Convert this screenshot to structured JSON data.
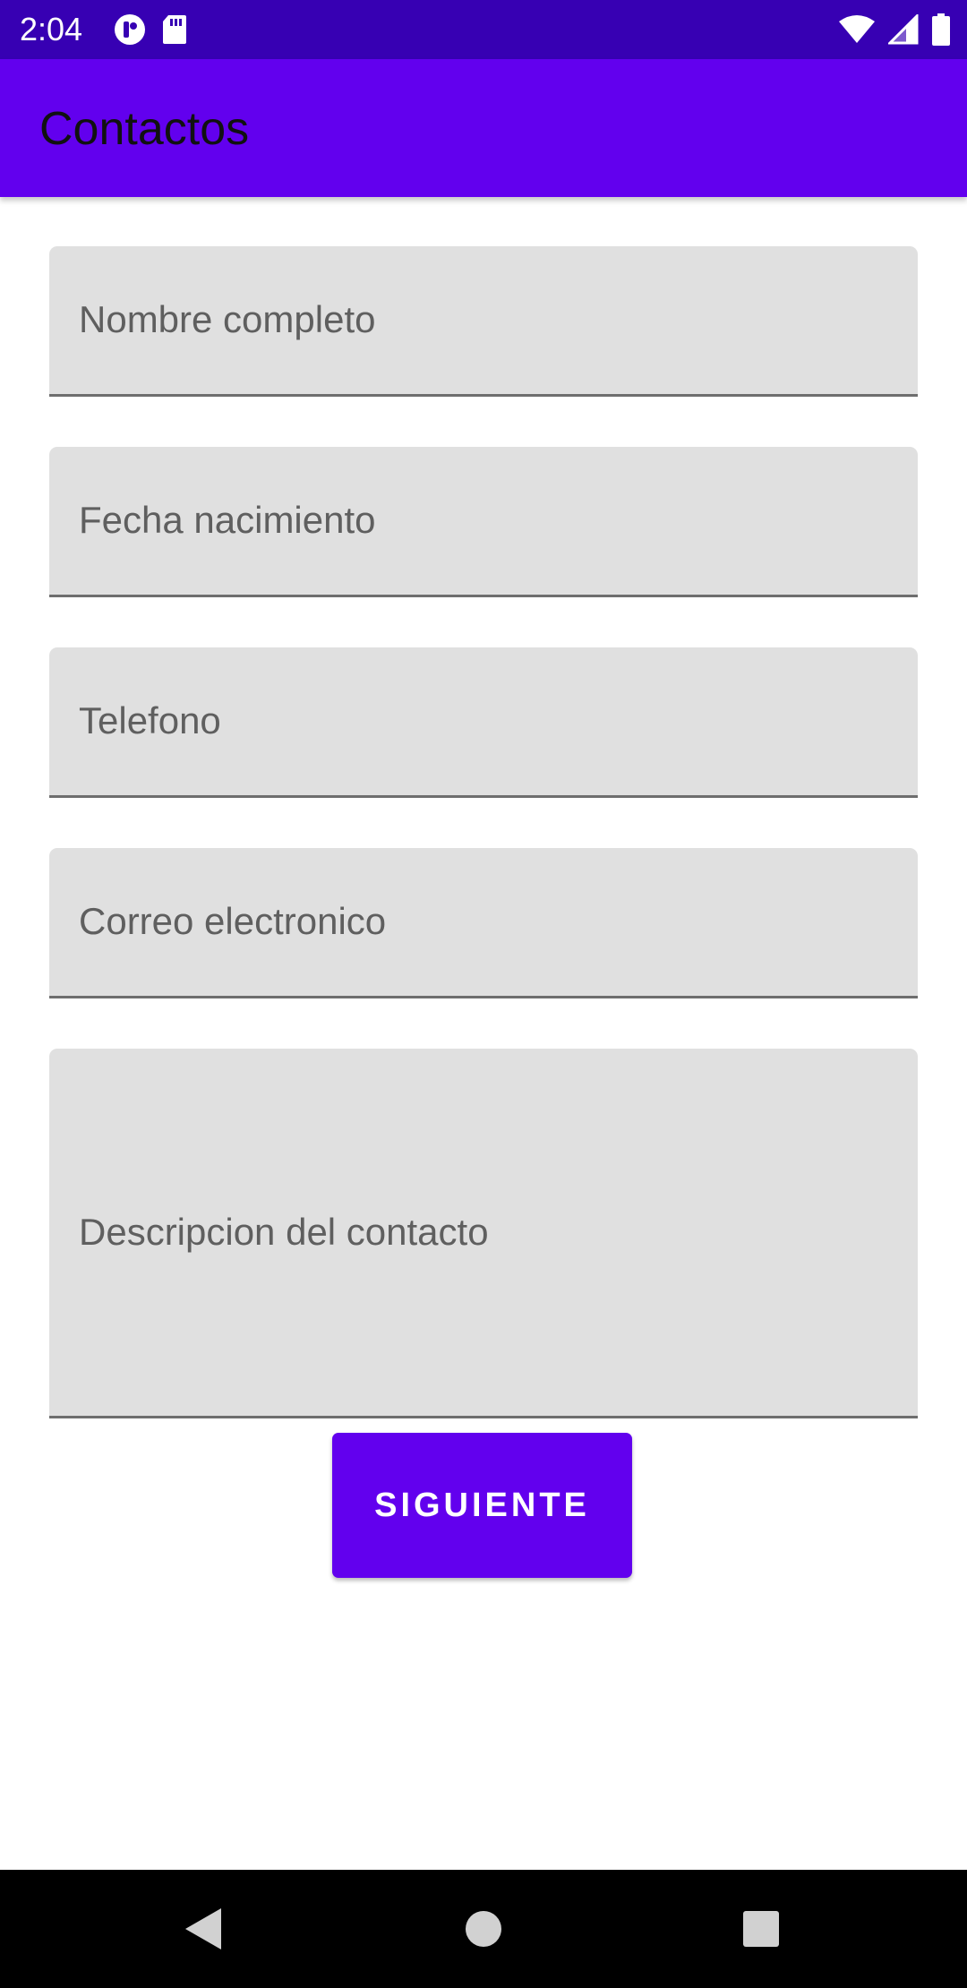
{
  "status_bar": {
    "time": "2:04",
    "left_icons": [
      "app-notification-icon",
      "sd-card-icon"
    ],
    "right_icons": [
      "wifi-icon",
      "cell-signal-icon",
      "battery-icon"
    ]
  },
  "app_bar": {
    "title": "Contactos"
  },
  "form": {
    "fields": [
      {
        "placeholder": "Nombre completo",
        "value": ""
      },
      {
        "placeholder": "Fecha nacimiento",
        "value": ""
      },
      {
        "placeholder": "Telefono",
        "value": ""
      },
      {
        "placeholder": "Correo electronico",
        "value": ""
      },
      {
        "placeholder": "Descripcion del contacto",
        "value": ""
      }
    ],
    "next_button_label": "SIGUIENTE"
  },
  "nav_bar": {
    "buttons": [
      "back-icon",
      "home-icon",
      "recents-icon"
    ]
  },
  "colors": {
    "status_bar": "#3700b3",
    "primary": "#6200ee",
    "field_background": "#e0e0e0",
    "placeholder_text": "#5f5f5f"
  }
}
